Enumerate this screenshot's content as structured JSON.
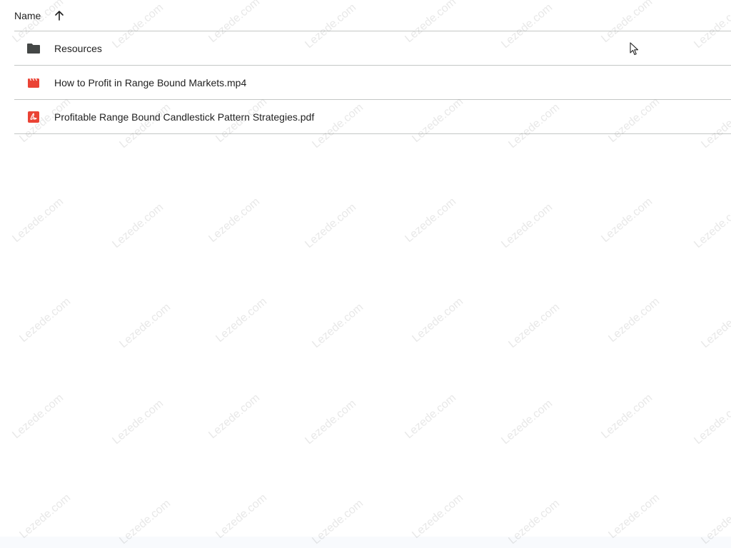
{
  "header": {
    "name_label": "Name",
    "sort_icon": "arrow-up-icon"
  },
  "files": [
    {
      "name": "Resources",
      "icon": "folder-icon",
      "icon_color": "#444746"
    },
    {
      "name": "How to Profit in Range Bound Markets.mp4",
      "icon": "video-icon",
      "icon_color": "#ea4335"
    },
    {
      "name": "Profitable Range Bound Candlestick Pattern Strategies.pdf",
      "icon": "pdf-icon",
      "icon_color": "#ea4335"
    }
  ],
  "watermark_text": "Lezede.com"
}
